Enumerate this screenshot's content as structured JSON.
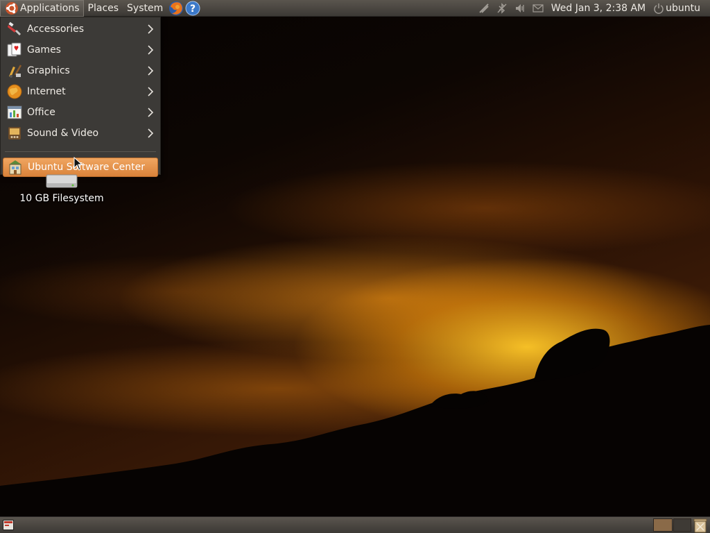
{
  "top_panel": {
    "menus": [
      {
        "label": "Applications"
      },
      {
        "label": "Places"
      },
      {
        "label": "System"
      }
    ],
    "launchers": [
      {
        "icon": "firefox-icon"
      },
      {
        "icon": "help-icon"
      }
    ],
    "tray_icons": [
      "network-icon",
      "bluetooth-icon",
      "volume-icon",
      "mail-icon"
    ],
    "clock": "Wed Jan  3,  2:38 AM",
    "user": "ubuntu"
  },
  "applications_menu": {
    "items": [
      {
        "label": "Accessories",
        "icon": "accessories-icon",
        "submenu": true
      },
      {
        "label": "Games",
        "icon": "games-icon",
        "submenu": true
      },
      {
        "label": "Graphics",
        "icon": "graphics-icon",
        "submenu": true
      },
      {
        "label": "Internet",
        "icon": "internet-icon",
        "submenu": true
      },
      {
        "label": "Office",
        "icon": "office-icon",
        "submenu": true
      },
      {
        "label": "Sound & Video",
        "icon": "sound-video-icon",
        "submenu": true
      }
    ],
    "footer_item": {
      "label": "Ubuntu Software Center",
      "icon": "software-center-icon",
      "highlighted": true
    }
  },
  "desktop": {
    "icons": [
      {
        "label": "10 GB Filesystem",
        "icon": "drive-icon"
      }
    ]
  },
  "colors": {
    "panel": "#4a4641",
    "menu_bg": "#3c3a37",
    "highlight": "#e4914b"
  }
}
